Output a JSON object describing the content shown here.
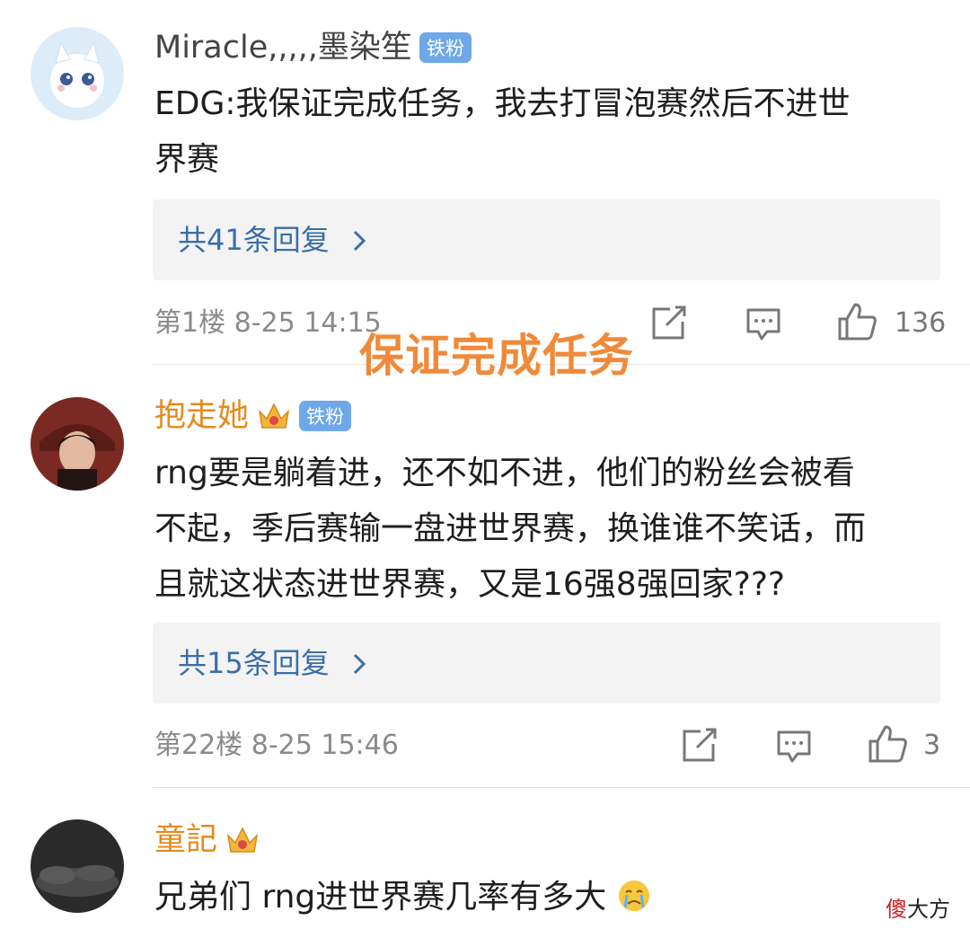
{
  "comments": [
    {
      "username": "Miracle,,,,,墨染笙",
      "badge": "铁粉",
      "text_line1": "EDG:我保证完成任务，我去打冒泡赛然后不进世",
      "text_line2": "界赛",
      "reply_label": "共41条回复",
      "floor": "第1楼",
      "date": "8-25",
      "time": "14:15",
      "likes": "136"
    },
    {
      "username": "抱走她",
      "badge": "铁粉",
      "text_line1": "rng要是躺着进，还不如不进，他们的粉丝会被看",
      "text_line2": "不起，季后赛输一盘进世界赛，换谁谁不笑话，而",
      "text_line3": "且就这状态进世界赛，又是16强8强回家???",
      "reply_label": "共15条回复",
      "floor": "第22楼",
      "date": "8-25",
      "time": "15:46",
      "likes": "3"
    },
    {
      "username": "童記",
      "text": "兄弟们  rng进世界赛几率有多大"
    }
  ],
  "overlay_caption": "保证完成任务",
  "watermark": {
    "accent": "傻",
    "rest": "大方"
  },
  "colors": {
    "accent_orange": "#f08a3a",
    "vip_name": "#e58a1e",
    "fan_badge": "#6ea8e8",
    "reply_link": "#3b6ea8"
  },
  "icons": [
    "share-icon",
    "comment-icon",
    "like-icon",
    "chevron-right-icon",
    "crown-icon",
    "crying-emoji"
  ]
}
